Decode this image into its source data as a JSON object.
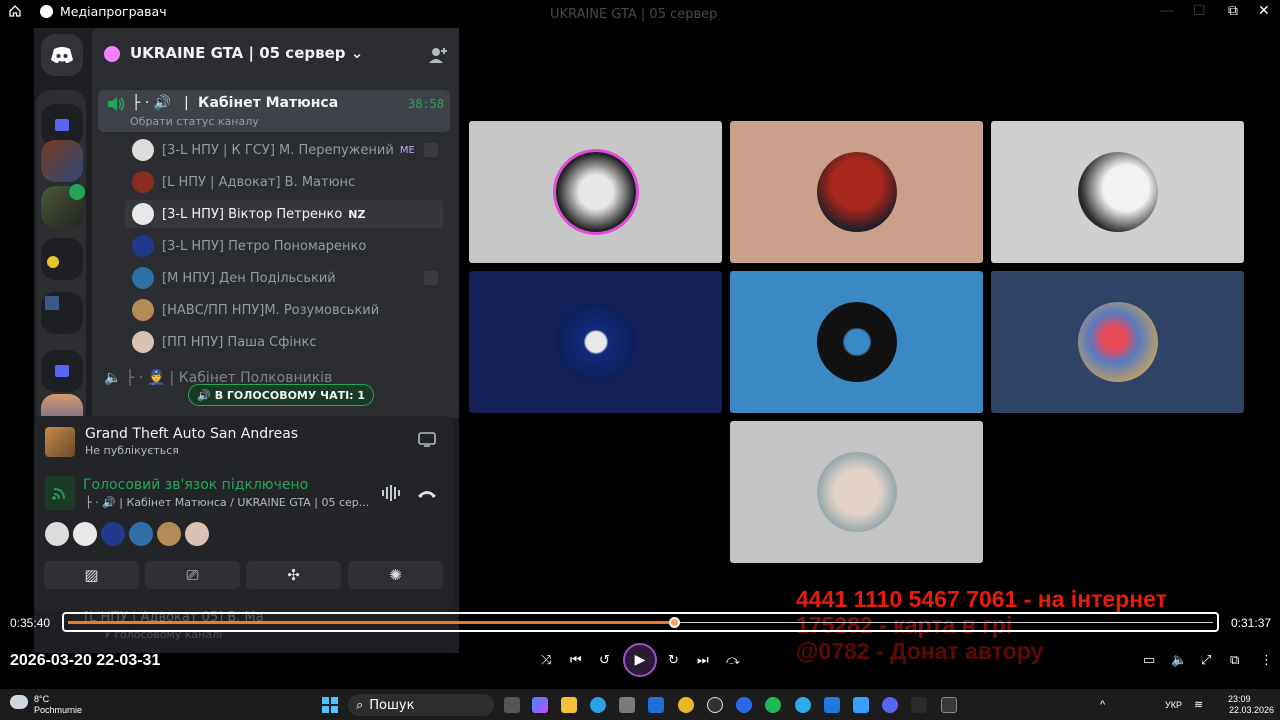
{
  "window": {
    "app_title": "Медіапрогравач",
    "ghost_title": "UKRAINE GTA | 05 сервер"
  },
  "discord": {
    "server_name": "UKRAINE GTA | 05 сервер",
    "voice_channel": {
      "prefix": "├ · 🔊",
      "name": "Кабінет Матюнса",
      "timer": "38:58",
      "status_prompt": "Обрати статус каналу"
    },
    "members": [
      {
        "name": "[3-L НПУ | К ГСУ] М. Перепужений",
        "badge": "ME",
        "color": "#dcdcdc"
      },
      {
        "name": "[L НПУ | Адвокат] В. Матюнс",
        "badge": "",
        "color": "#8a2d20"
      },
      {
        "name": "[3-L НПУ] Віктор Петренко",
        "badge": "NZ",
        "color": "#e8e8e8"
      },
      {
        "name": "[3-L НПУ] Петро Пономаренко",
        "badge": "",
        "color": "#1f3a8a"
      },
      {
        "name": "[М НПУ] Ден Подільський",
        "badge": "",
        "color": "#2f6fa8"
      },
      {
        "name": "[НАВС/ПП НПУ]М. Розумовський",
        "badge": "",
        "color": "#b48a56"
      },
      {
        "name": "[ПП НПУ] Паша Сфінкс",
        "badge": "",
        "color": "#d7c2b4"
      }
    ],
    "next_channel": "Кабінет Полковників",
    "voice_chat_pill": "В ГОЛОСОВОМУ ЧАТІ: 1",
    "activity": {
      "game": "Grand Theft Auto San Andreas",
      "visibility": "Не публікується"
    },
    "voice_status": {
      "title": "Голосовий зв'язок підключено",
      "channel": "├ · 🔊 | Кабінет Матюнса / UKRAINE GTA | 05 сер..."
    },
    "bottom_ghost": "[L НПУ | Адвокат 05] В. Ма",
    "bottom_ghost_sub": "У голосовому каналі"
  },
  "overlay": {
    "lines": [
      "4441 1110 5467 7061 - на інтернет",
      "175282 - карта в грі",
      "@0782 - Донат автору"
    ]
  },
  "player": {
    "elapsed": "0:35:40",
    "remaining": "0:31:37",
    "progress_fraction": 0.53,
    "recording_stamp": "2026-03-20 22-03-31"
  },
  "taskbar": {
    "weather_temp": "8°C",
    "weather_place": "Pochmurnie",
    "search_label": "Пошук",
    "lang": "УКР",
    "time": "23:09",
    "date": "22.03.2026"
  },
  "colors": {
    "discord_green": "#23a559",
    "accent_orange": "#f07b24",
    "overlay_red": "#e81b0d"
  },
  "icons": [
    "home-icon",
    "discord-icon",
    "add-member-icon",
    "speaker-icon",
    "signal-icon",
    "disconnect-icon",
    "camera-off-icon",
    "screen-share-icon",
    "activities-icon",
    "soundboard-icon",
    "play-icon",
    "search-icon"
  ]
}
